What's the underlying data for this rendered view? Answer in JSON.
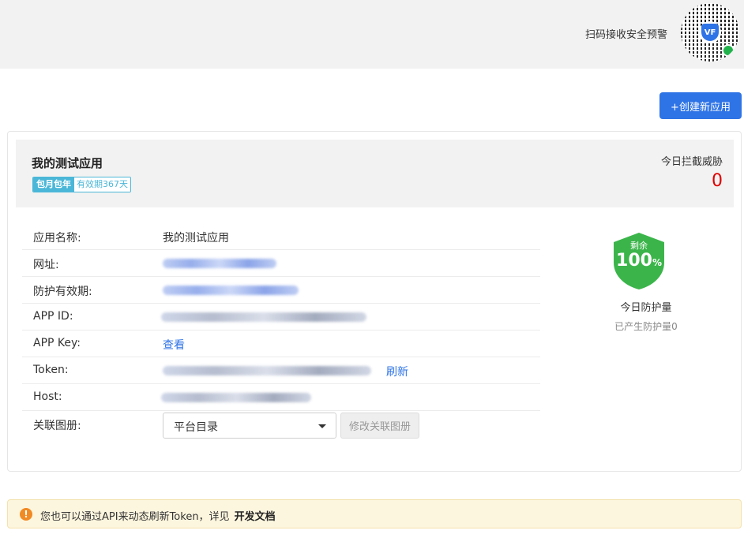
{
  "header": {
    "scan_text": "扫码接收安全预警",
    "qr_logo_text": "VF"
  },
  "toolbar": {
    "create_label": "+创建新应用"
  },
  "app": {
    "title": "我的测试应用",
    "plan_tag": "包月包年",
    "validity_tag": "有效期367天",
    "threat_label": "今日拦截威胁",
    "threat_value": "0",
    "rows": {
      "name_label": "应用名称:",
      "name_value": "我的测试应用",
      "url_label": "网址:",
      "protect_label": "防护有效期:",
      "appid_label": "APP ID:",
      "appkey_label": "APP Key:",
      "appkey_link": "查看",
      "token_label": "Token:",
      "token_link": "刷新",
      "host_label": "Host:",
      "album_label": "关联图册:",
      "album_selected": "平台目录",
      "album_edit": "修改关联图册"
    },
    "quota": {
      "remaining_label": "剩余",
      "remaining_pct": "100",
      "pct_sign": "%",
      "remaining_fraction": 1.0,
      "today_label": "今日防护量",
      "produced_label": "已产生防护量0"
    }
  },
  "notice": {
    "text": "您也可以通过API来动态刷新Token，详见",
    "link": "开发文档"
  },
  "colors": {
    "primary": "#2f74e6",
    "threat": "#e00000",
    "shield": "#3bb54a",
    "tag": "#4bb7d8",
    "notice_bg": "#fdf6de",
    "warning_icon": "#f08a24"
  }
}
